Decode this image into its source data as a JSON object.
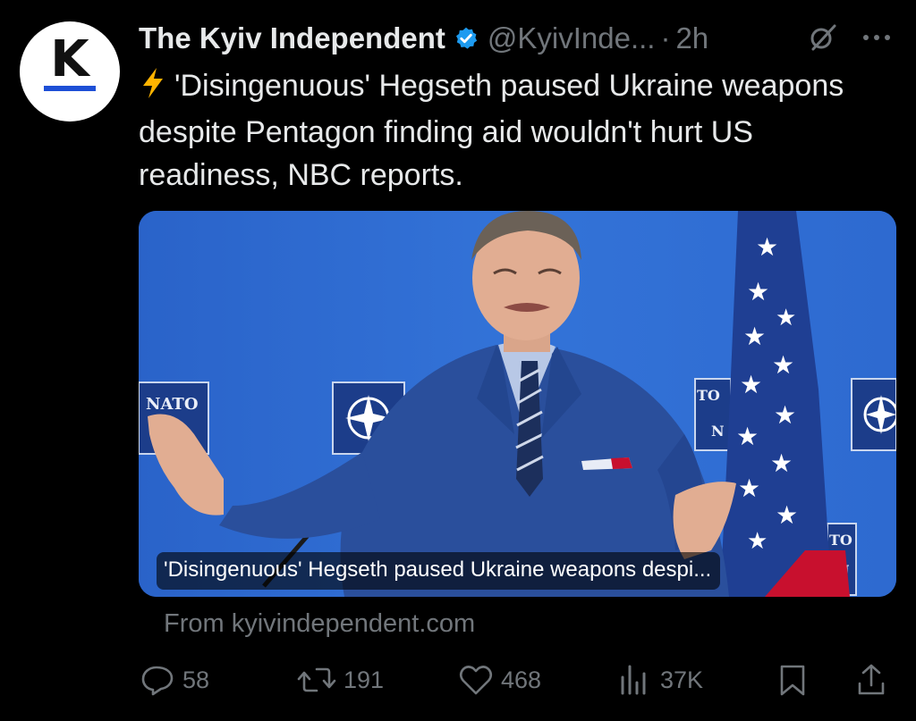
{
  "tweet": {
    "avatar_letter": "K",
    "author_name": "The Kyiv Independent",
    "handle": "@KyivInde...",
    "separator": "·",
    "time": "2h",
    "text": "'Disingenuous' Hegseth paused Ukraine weapons despite Pentagon finding aid wouldn't hurt US readiness, NBC reports.",
    "lead_icon": "lightning-bolt-icon"
  },
  "card": {
    "caption": "'Disingenuous' Hegseth paused Ukraine weapons despi...",
    "source": "From kyivindependent.com",
    "image_signs": [
      "NATO",
      "TO",
      "N",
      "TO",
      "N"
    ]
  },
  "actions": {
    "replies": "58",
    "reposts": "191",
    "likes": "468",
    "views": "37K"
  },
  "colors": {
    "background": "#000000",
    "text": "#e7e9ea",
    "muted": "#71767b",
    "verified": "#1d9bf0",
    "photo_backdrop": "#2c6ad4",
    "suit": "#2a4f9c"
  }
}
